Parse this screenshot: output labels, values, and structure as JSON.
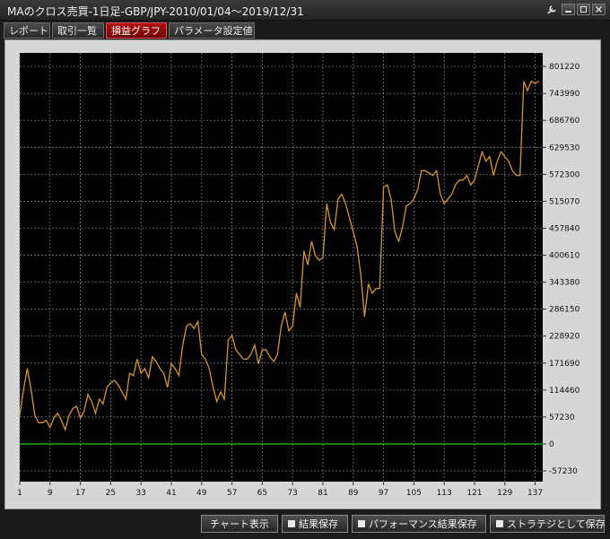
{
  "window": {
    "title": "MAのクロス売買-1日足-GBP/JPY-2010/01/04～2019/12/31",
    "controls": [
      "wrench-icon",
      "minimize-icon",
      "restore-icon",
      "close-icon"
    ]
  },
  "tabs": [
    {
      "label": "レポート",
      "active": false
    },
    {
      "label": "取引一覧",
      "active": false
    },
    {
      "label": "損益グラフ",
      "active": true
    },
    {
      "label": "パラメータ設定値",
      "active": false
    }
  ],
  "buttons": {
    "chart": "チャート表示",
    "save_result": "結果保存",
    "save_performance": "パフォーマンス結果保存",
    "save_strategy": "ストラテジとして保存"
  },
  "chart_data": {
    "type": "line",
    "title": "",
    "xlabel": "",
    "ylabel": "",
    "x_ticks": [
      1,
      9,
      17,
      25,
      33,
      41,
      49,
      57,
      65,
      73,
      81,
      89,
      97,
      105,
      113,
      121,
      129,
      137
    ],
    "y_ticks": [
      -57230,
      0,
      57230,
      114460,
      171690,
      228920,
      286150,
      343380,
      400610,
      457840,
      515070,
      572300,
      629530,
      686760,
      743990,
      801220
    ],
    "xlim": [
      1,
      139
    ],
    "ylim": [
      -80000,
      830000
    ],
    "zero_line_color": "#22cc22",
    "line_color": "#d7952f",
    "background": "#000000",
    "grid": true,
    "series": [
      {
        "values": [
          60000,
          115000,
          160000,
          115000,
          60000,
          45000,
          45000,
          50000,
          35000,
          55000,
          65000,
          50000,
          30000,
          60000,
          75000,
          80000,
          55000,
          70000,
          105000,
          90000,
          65000,
          95000,
          85000,
          120000,
          130000,
          135000,
          125000,
          110000,
          95000,
          150000,
          145000,
          180000,
          150000,
          160000,
          140000,
          185000,
          175000,
          160000,
          150000,
          120000,
          170000,
          160000,
          145000,
          210000,
          250000,
          255000,
          245000,
          260000,
          190000,
          180000,
          160000,
          120000,
          90000,
          110000,
          95000,
          220000,
          230000,
          200000,
          190000,
          180000,
          180000,
          190000,
          210000,
          170000,
          200000,
          200000,
          185000,
          175000,
          190000,
          250000,
          280000,
          240000,
          250000,
          320000,
          290000,
          410000,
          380000,
          430000,
          400000,
          390000,
          395000,
          510000,
          470000,
          455000,
          520000,
          530000,
          510000,
          480000,
          450000,
          420000,
          360000,
          270000,
          340000,
          320000,
          330000,
          330000,
          545000,
          550000,
          520000,
          450000,
          430000,
          460000,
          505000,
          510000,
          520000,
          540000,
          580000,
          580000,
          575000,
          570000,
          580000,
          530000,
          510000,
          520000,
          530000,
          550000,
          560000,
          560000,
          570000,
          550000,
          560000,
          590000,
          620000,
          600000,
          610000,
          570000,
          600000,
          620000,
          610000,
          600000,
          580000,
          570000,
          570000,
          770000,
          750000,
          770000,
          765000,
          770000
        ]
      }
    ]
  }
}
